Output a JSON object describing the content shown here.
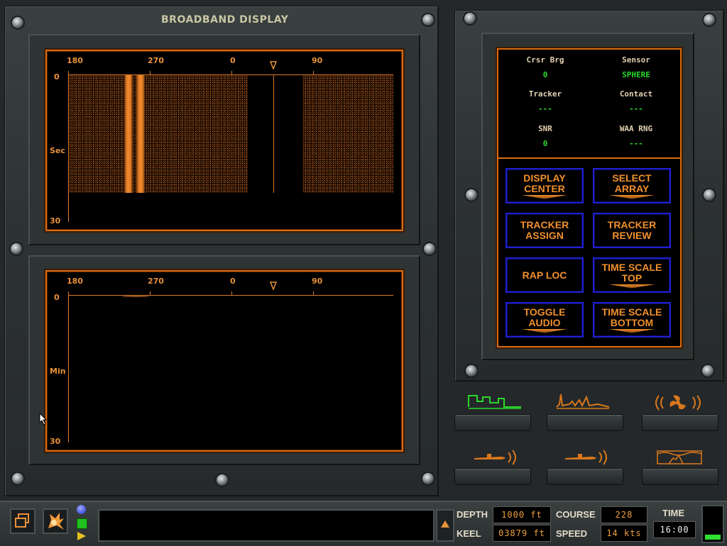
{
  "window": {
    "title": "BROADBAND DISPLAY"
  },
  "top_display": {
    "bearing_ticks": [
      "180",
      "270",
      "0",
      "90"
    ],
    "y_top": "0",
    "y_unit": "Sec",
    "y_bottom": "30"
  },
  "bottom_display": {
    "bearing_ticks": [
      "180",
      "270",
      "0",
      "90"
    ],
    "y_top": "0",
    "y_unit": "Min",
    "y_bottom": "30"
  },
  "info_panel": {
    "crsr_brg_label": "Crsr Brg",
    "crsr_brg_value": "0",
    "sensor_label": "Sensor",
    "sensor_value": "SPHERE",
    "tracker_label": "Tracker",
    "tracker_value": "---",
    "contact_label": "Contact",
    "contact_value": "---",
    "snr_label": "SNR",
    "snr_value": "0",
    "waa_rng_label": "WAA RNG",
    "waa_rng_value": "---"
  },
  "buttons": {
    "display_center": [
      "DISPLAY",
      "CENTER"
    ],
    "select_array": [
      "SELECT",
      "ARRAY"
    ],
    "tracker_assign": [
      "TRACKER",
      "ASSIGN"
    ],
    "tracker_review": [
      "TRACKER",
      "REVIEW"
    ],
    "rap_loc": [
      "RAP LOC"
    ],
    "time_scale_top": [
      "TIME SCALE",
      "TOP"
    ],
    "toggle_audio": [
      "TOGGLE",
      "AUDIO"
    ],
    "time_scale_bottom": [
      "TIME SCALE",
      "BOTTOM"
    ]
  },
  "status_bar": {
    "depth_label": "DEPTH",
    "depth_value": "1000  ft",
    "keel_label": "KEEL",
    "keel_value": "03879  ft",
    "course_label": "COURSE",
    "course_value": "228",
    "speed_label": "SPEED",
    "speed_value": "14 kts",
    "time_label": "TIME",
    "time_value": "16:00",
    "message": ""
  },
  "colors": {
    "accent_orange": "#d86a10",
    "button_border_blue": "#2020d0",
    "value_green": "#2bd82b"
  },
  "icons": [
    "windows-icon",
    "explosion-icon",
    "broadband-icon",
    "narrowband-icon",
    "propeller-icon",
    "sub-left-icon",
    "sub-right-icon",
    "waterfall-icon"
  ]
}
